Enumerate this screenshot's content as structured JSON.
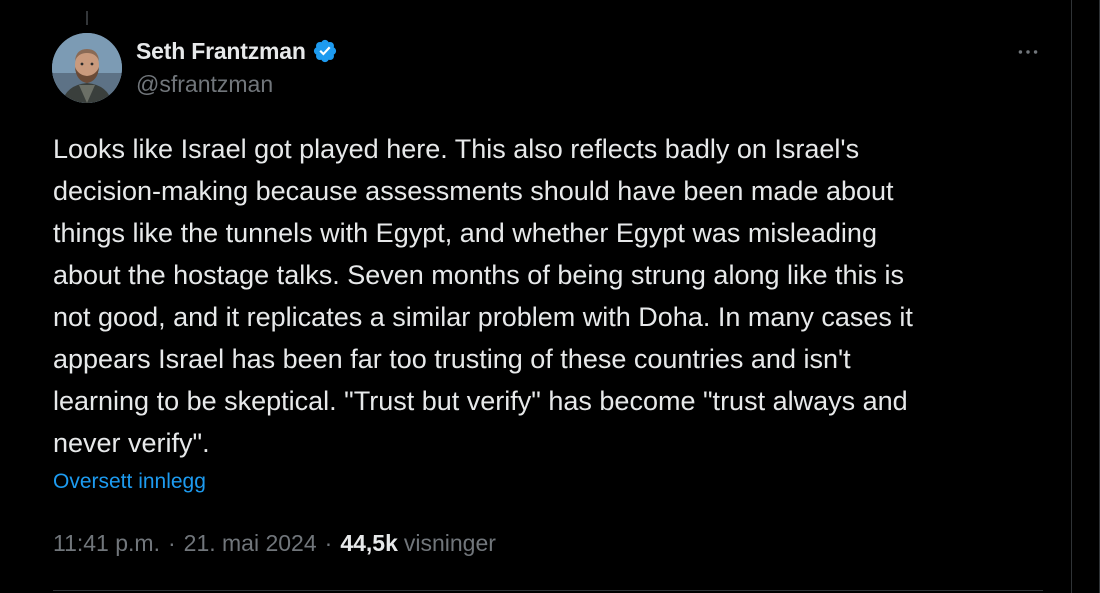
{
  "author": {
    "display_name": "Seth Frantzman",
    "handle": "@sfrantzman",
    "verified": true,
    "verified_color": "#1d9bf0"
  },
  "tweet": {
    "text": "Looks like Israel got played here. This also reflects badly on Israel's\ndecision-making because assessments should have been made about\nthings like the tunnels with Egypt, and whether Egypt was misleading\nabout the hostage talks. Seven months of being strung along like this is\nnot good, and it replicates a similar problem with Doha. In many cases it\nappears Israel has been far too trusting of these countries and isn't\nlearning to be skeptical. \"Trust but verify\" has become \"trust always and\nnever verify\".",
    "translate_label": "Oversett innlegg"
  },
  "meta": {
    "time": "11:41 p.m.",
    "separator": "·",
    "date": "21. mai 2024",
    "views_count": "44,5k",
    "views_label": "visninger"
  },
  "icons": {
    "more": "more-horizontal-icon",
    "verified": "verified-badge-icon"
  },
  "colors": {
    "background": "#000000",
    "text_primary": "#e7e9ea",
    "text_secondary": "#71767b",
    "link": "#1d9bf0",
    "border": "#2f3336"
  }
}
